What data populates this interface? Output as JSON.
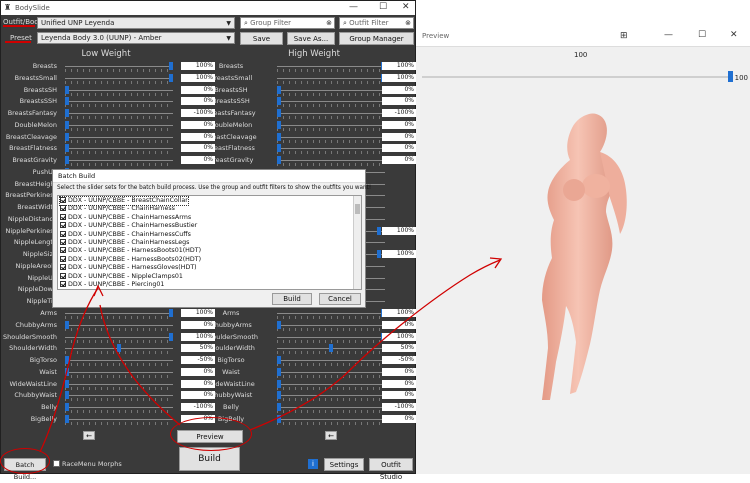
{
  "preview_window": {
    "title": "Preview",
    "slider_value": "100",
    "slider_max": "100",
    "slider_level": 1.0
  },
  "bodyslide": {
    "title": "BodySlide",
    "outfit_label": "Outfit/Body",
    "outfit_value": "Unified UNP Leyenda",
    "group_filter_placeholder": "Group Filter",
    "outfit_filter_placeholder": "Outfit Filter",
    "preset_label": "Preset",
    "preset_value": "Leyenda Body 3.0 (UUNP) - Amber",
    "save": "Save",
    "save_as": "Save As...",
    "group_manager": "Group Manager",
    "low_weight": "Low Weight",
    "high_weight": "High Weight",
    "sliders_top": [
      {
        "name": "Breasts",
        "low": "100%",
        "high": "100%",
        "lp": 1.0,
        "hp": 1.0
      },
      {
        "name": "BreastsSmall",
        "low": "100%",
        "high": "100%",
        "lp": 1.0,
        "hp": 1.0
      },
      {
        "name": "BreastsSH",
        "low": "0%",
        "high": "0%",
        "lp": 0.0,
        "hp": 0.0
      },
      {
        "name": "BreastsSSH",
        "low": "0%",
        "high": "0%",
        "lp": 0.0,
        "hp": 0.0
      },
      {
        "name": "BreastsFantasy",
        "low": "-100%",
        "high": "-100%",
        "lp": 0.0,
        "hp": 0.0
      },
      {
        "name": "DoubleMelon",
        "low": "0%",
        "high": "0%",
        "lp": 0.0,
        "hp": 0.0
      },
      {
        "name": "BreastCleavage",
        "low": "0%",
        "high": "0%",
        "lp": 0.0,
        "hp": 0.0
      },
      {
        "name": "BreastFlatness",
        "low": "0%",
        "high": "0%",
        "lp": 0.0,
        "hp": 0.0
      },
      {
        "name": "BreastGravity",
        "low": "0%",
        "high": "0%",
        "lp": 0.0,
        "hp": 0.0
      }
    ],
    "slider_names_mid": [
      "PushUp",
      "BreastHeight",
      "BreastPerkiness",
      "BreastWidth",
      "NippleDistance",
      "NipplePerkiness",
      "NippleLength",
      "NippleSize",
      "NippleAreola",
      "NippleUp",
      "NippleDown",
      "NippleTip"
    ],
    "mid_values_right": [
      {
        "text": "100%",
        "row": 5
      },
      {
        "text": "100%",
        "row": 7
      }
    ],
    "sliders_bottom": [
      {
        "name": "Arms",
        "low": "100%",
        "high": "100%",
        "lp": 1.0,
        "hp": 1.0
      },
      {
        "name": "ChubbyArms",
        "low": "0%",
        "high": "0%",
        "lp": 0.0,
        "hp": 0.0
      },
      {
        "name": "ShoulderSmooth",
        "low": "100%",
        "high": "100%",
        "lp": 1.0,
        "hp": 1.0
      },
      {
        "name": "ShoulderWidth",
        "low": "50%",
        "high": "50%",
        "lp": 0.5,
        "hp": 0.5
      },
      {
        "name": "BigTorso",
        "low": "-50%",
        "high": "-50%",
        "lp": 0.0,
        "hp": 0.0
      },
      {
        "name": "Waist",
        "low": "0%",
        "high": "0%",
        "lp": 0.0,
        "hp": 0.0
      },
      {
        "name": "WideWaistLine",
        "low": "0%",
        "high": "0%",
        "lp": 0.0,
        "hp": 0.0
      },
      {
        "name": "ChubbyWaist",
        "low": "0%",
        "high": "0%",
        "lp": 0.0,
        "hp": 0.0
      },
      {
        "name": "Belly",
        "low": "-100%",
        "high": "-100%",
        "lp": 0.0,
        "hp": 0.0
      },
      {
        "name": "BigBelly",
        "low": "0%",
        "high": "0%",
        "lp": 0.0,
        "hp": 0.0
      }
    ],
    "prev_arrow": "←",
    "next_arrow": "←",
    "preview": "Preview",
    "build": "Build",
    "batch_build": "Batch Build...",
    "racemenu_morphs": "RaceMenu Morphs",
    "settings": "Settings",
    "outfit_studio": "Outfit Studio",
    "info_icon": "i"
  },
  "batch_dialog": {
    "title": "Batch Build",
    "instructions": "Select the slider sets for the batch build process. Use the group and outfit filters to show the outfits you want!",
    "items": [
      "DDX - UUNP/CBBE - BreastChainCollar",
      "DDX - UUNP/CBBE - ChainHarness",
      "DDX - UUNP/CBBE - ChainHarnessArms",
      "DDX - UUNP/CBBE - ChainHarnessBustier",
      "DDX - UUNP/CBBE - ChainHarnessCuffs",
      "DDX - UUNP/CBBE - ChainHarnessLegs",
      "DDX - UUNP/CBBE - HarnessBoots01(HDT)",
      "DDX - UUNP/CBBE - HarnessBoots02(HDT)",
      "DDX - UUNP/CBBE - HarnessGloves(HDT)",
      "DDX - UUNP/CBBE - NippleClamps01",
      "DDX - UUNP/CBBE - Piercing01"
    ],
    "build": "Build",
    "cancel": "Cancel"
  },
  "colors": {
    "accent": "#1f6fd1",
    "annotation": "#d00000",
    "window_bg": "#3a3a3a",
    "body": "#f2b5a4"
  }
}
